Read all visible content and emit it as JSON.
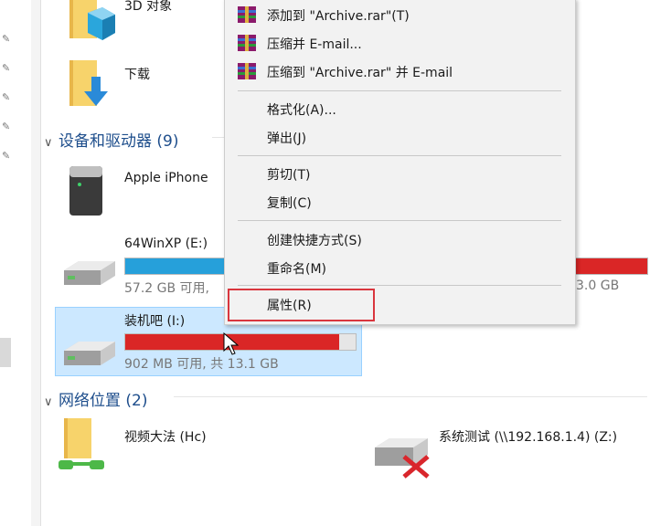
{
  "folders": {
    "objects3d": "3D 对象",
    "downloads": "下载"
  },
  "devices": {
    "header": "设备和驱动器 (9)",
    "iphone": "Apple iPhone",
    "drive_e": {
      "label": "64WinXP  (E:)",
      "free": "57.2 GB 可用,",
      "partial_right": "3.0 GB"
    },
    "drive_i": {
      "label": "装机吧 (I:)",
      "free": "902 MB 可用, 共 13.1 GB",
      "used_fraction": 0.93
    }
  },
  "network": {
    "header": "网络位置 (2)",
    "items": [
      "视频大法 (Hc)",
      "系统测试 (\\\\192.168.1.4) (Z:)"
    ]
  },
  "context_menu": {
    "items": [
      "添加到 \"Archive.rar\"(T)",
      "压缩并 E-mail...",
      "压缩到 \"Archive.rar\" 并 E-mail",
      "格式化(A)...",
      "弹出(J)",
      "剪切(T)",
      "复制(C)",
      "创建快捷方式(S)",
      "重命名(M)",
      "属性(R)"
    ]
  },
  "colors": {
    "accent_blue": "#26a0da",
    "warning_red": "#da2626",
    "selection_bg": "#cce8ff",
    "highlight_box": "#d9363e"
  }
}
